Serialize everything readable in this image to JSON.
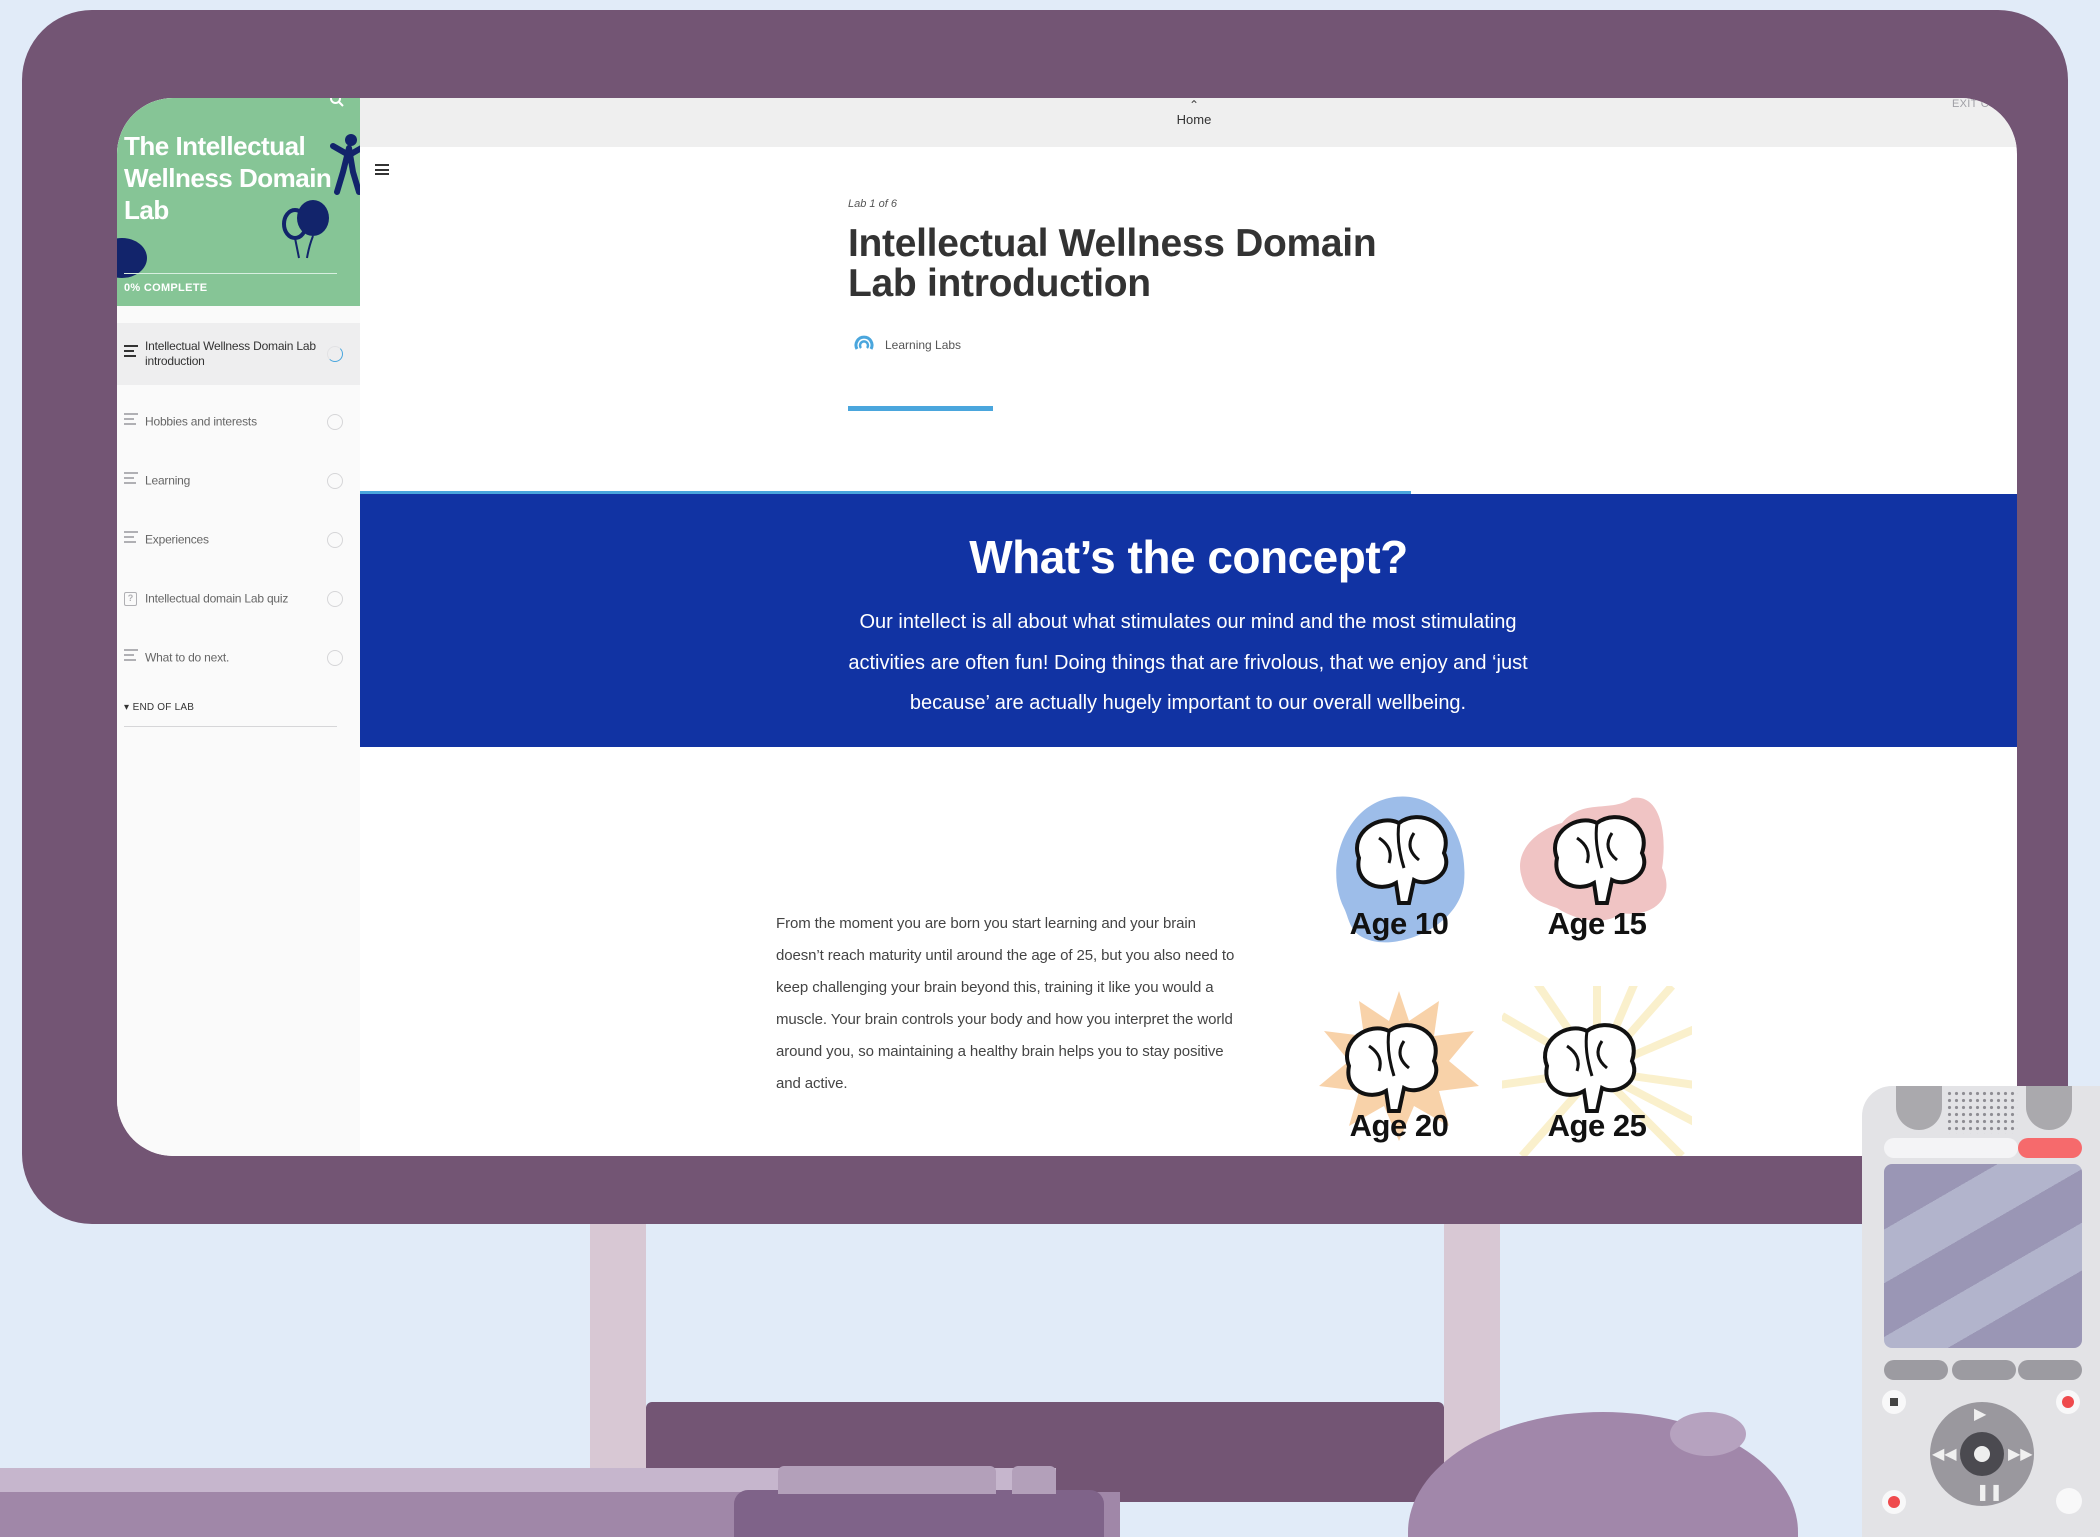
{
  "sidebar": {
    "course_title": "The Intellectual Wellness Domain Lab",
    "progress_text": "0% COMPLETE",
    "lessons": [
      {
        "label": "Intellectual Wellness Domain Lab introduction",
        "type": "lesson",
        "active": true
      },
      {
        "label": "Hobbies and interests",
        "type": "lesson"
      },
      {
        "label": "Learning",
        "type": "lesson"
      },
      {
        "label": "Experiences",
        "type": "lesson"
      },
      {
        "label": "Intellectual domain Lab quiz",
        "type": "quiz"
      },
      {
        "label": "What to do next.",
        "type": "lesson"
      }
    ],
    "section_label": "END OF LAB",
    "search_icon": "search-icon"
  },
  "topbar": {
    "home_label": "Home",
    "exit_label": "EXIT CO"
  },
  "lesson": {
    "counter": "Lab 1 of 6",
    "title": "Intellectual Wellness Domain Lab introduction",
    "author": "Learning Labs"
  },
  "concept": {
    "heading": "What’s the concept?",
    "body": "Our intellect is all about what stimulates our mind and the most stimulating activities are often fun! Doing things that are frivolous, that we enjoy and ‘just because’ are actually hugely important to our overall wellbeing."
  },
  "body_text": "From the moment you are born you start learning and your brain doesn’t reach maturity until around the age of 25, but you also need to keep challenging your brain beyond this, training it like you would a muscle. Your brain controls your body and how you interpret the world around you, so maintaining a healthy brain helps you to stay positive and active.",
  "ages": [
    {
      "label": "Age 10",
      "color": "#9dbde9"
    },
    {
      "label": "Age 15",
      "color": "#f0c4c4"
    },
    {
      "label": "Age 20",
      "color": "#f8d2a9"
    },
    {
      "label": "Age 25",
      "color": "#faf0cc"
    }
  ],
  "colors": {
    "accent": "#4aa6dd",
    "banner": "#1133a3",
    "sidebar_header": "#86c596",
    "monitor": "#735574"
  }
}
